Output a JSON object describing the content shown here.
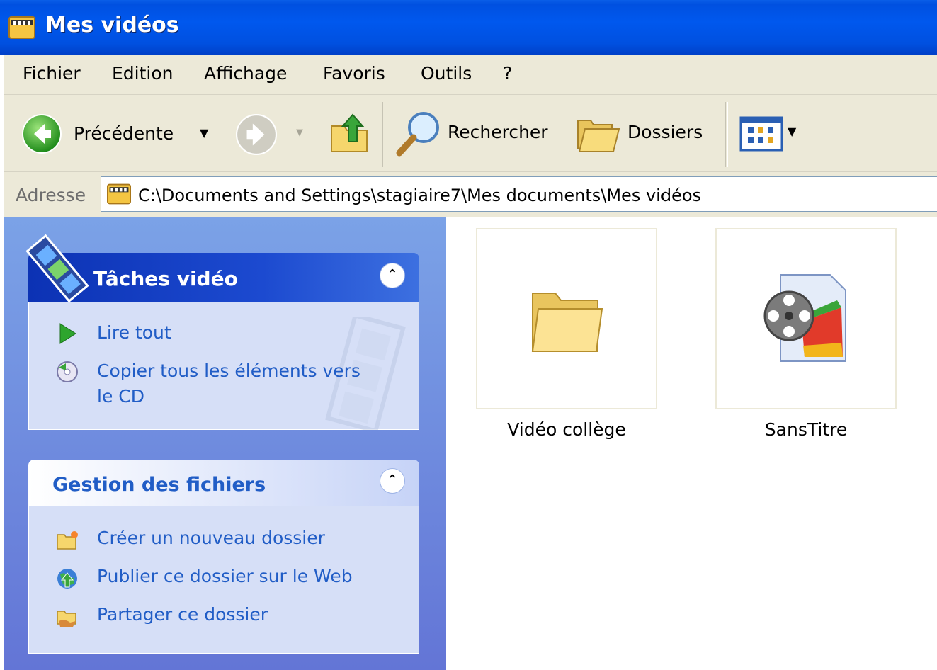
{
  "window": {
    "title": "Mes vidéos"
  },
  "menubar": {
    "items": [
      "Fichier",
      "Edition",
      "Affichage",
      "Favoris",
      "Outils",
      "?"
    ]
  },
  "toolbar": {
    "back_label": "Précédente",
    "search_label": "Rechercher",
    "folders_label": "Dossiers"
  },
  "address": {
    "label": "Adresse",
    "path": "C:\\Documents and Settings\\stagiaire7\\Mes documents\\Mes vidéos"
  },
  "taskpane": {
    "video_tasks": {
      "title": "Tâches vidéo",
      "links": [
        "Lire tout",
        "Copier tous les éléments vers",
        "le CD"
      ]
    },
    "file_tasks": {
      "title": "Gestion des fichiers",
      "links": [
        "Créer un nouveau dossier",
        "Publier ce dossier sur le Web",
        "Partager ce dossier"
      ]
    }
  },
  "files": [
    {
      "name": "Vidéo collège",
      "icon": "folder-icon"
    },
    {
      "name": "SansTitre",
      "icon": "video-file-icon"
    }
  ],
  "colors": {
    "titlebar": "#0054e3",
    "link": "#215dc6",
    "taskpane": "#6d8ce0"
  }
}
